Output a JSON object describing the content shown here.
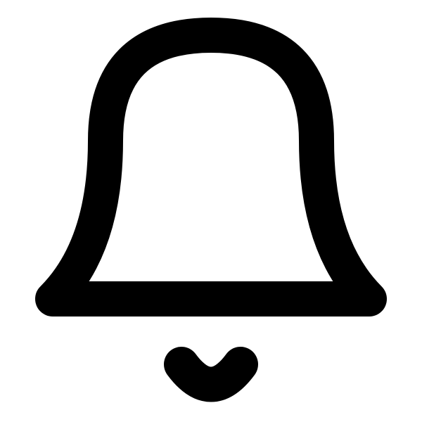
{
  "icon": {
    "name": "bell-icon",
    "color": "#000000",
    "background": "#ffffff"
  }
}
